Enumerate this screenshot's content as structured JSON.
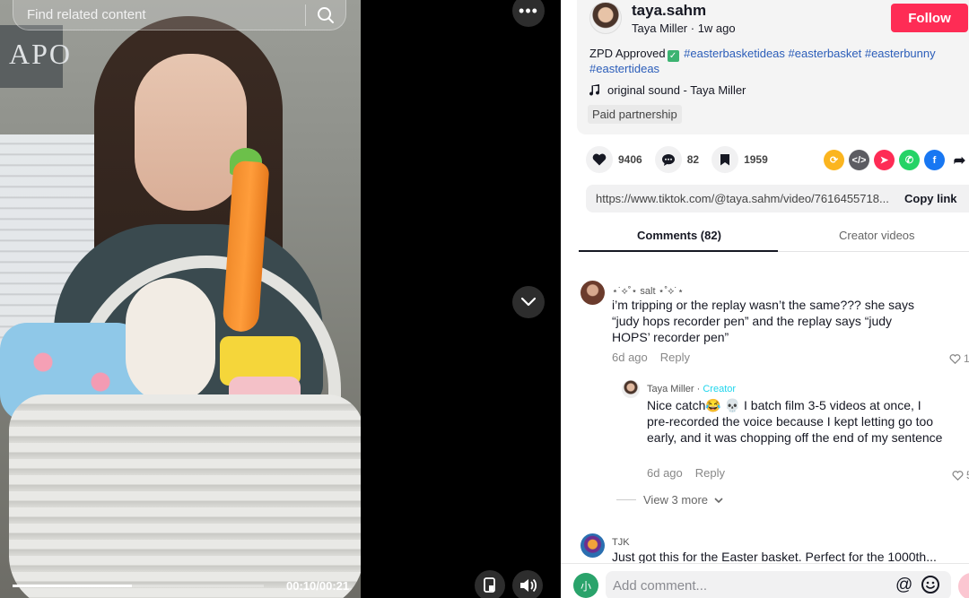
{
  "video": {
    "search_placeholder": "Find related content",
    "time": "00:10/00:21",
    "progress": 0.476,
    "wall_sign": "APO"
  },
  "post": {
    "username": "taya.sahm",
    "display_name": "Taya Miller",
    "age": "1w ago",
    "follow_label": "Follow",
    "desc_prefix": "ZPD Approved",
    "tags": [
      "#easterbasketideas",
      "#easterbasket",
      "#easterbunny",
      "#eastertideas"
    ],
    "sound": "original sound - Taya Miller",
    "paid_label": "Paid partnership"
  },
  "stats": {
    "likes": "9406",
    "comments": "82",
    "saves": "1959"
  },
  "share_icons": [
    "repost-icon",
    "embed-icon",
    "send-icon",
    "whatsapp-icon",
    "facebook-icon",
    "share-arrow-icon"
  ],
  "link": {
    "url": "https://www.tiktok.com/@taya.sahm/video/7616455718...",
    "copy_label": "Copy link"
  },
  "tabs": {
    "comments": "Comments (82)",
    "creator": "Creator videos"
  },
  "comments": [
    {
      "user": "⋆˙⟡˚⋆ salt ⋆˚⟡˙⋆",
      "text": "i’m tripping or the replay wasn’t the same??? she says “judy hops recorder pen” and the replay says “judy HOPS’ recorder pen”",
      "age": "6d ago",
      "reply": "Reply",
      "likes": "1"
    },
    {
      "user": "Taya Miller",
      "badge": "Creator",
      "text": "Nice catch😂 💀 I batch film 3-5 videos at once, I pre-recorded the voice because I kept letting go too early, and it was chopping off the end of my sentence",
      "age": "6d ago",
      "reply": "Reply",
      "likes": "5"
    },
    {
      "user": "TJK",
      "text": "Just got this for the Easter basket. Perfect for the 1000th..."
    }
  ],
  "view_more": "View 3 more",
  "composer": {
    "avatar_text": "小",
    "placeholder": "Add comment...",
    "at": "@"
  },
  "colors": {
    "follow": "#fe2c55",
    "hashtag": "#2b5db9",
    "creator": "#20d5ec"
  }
}
